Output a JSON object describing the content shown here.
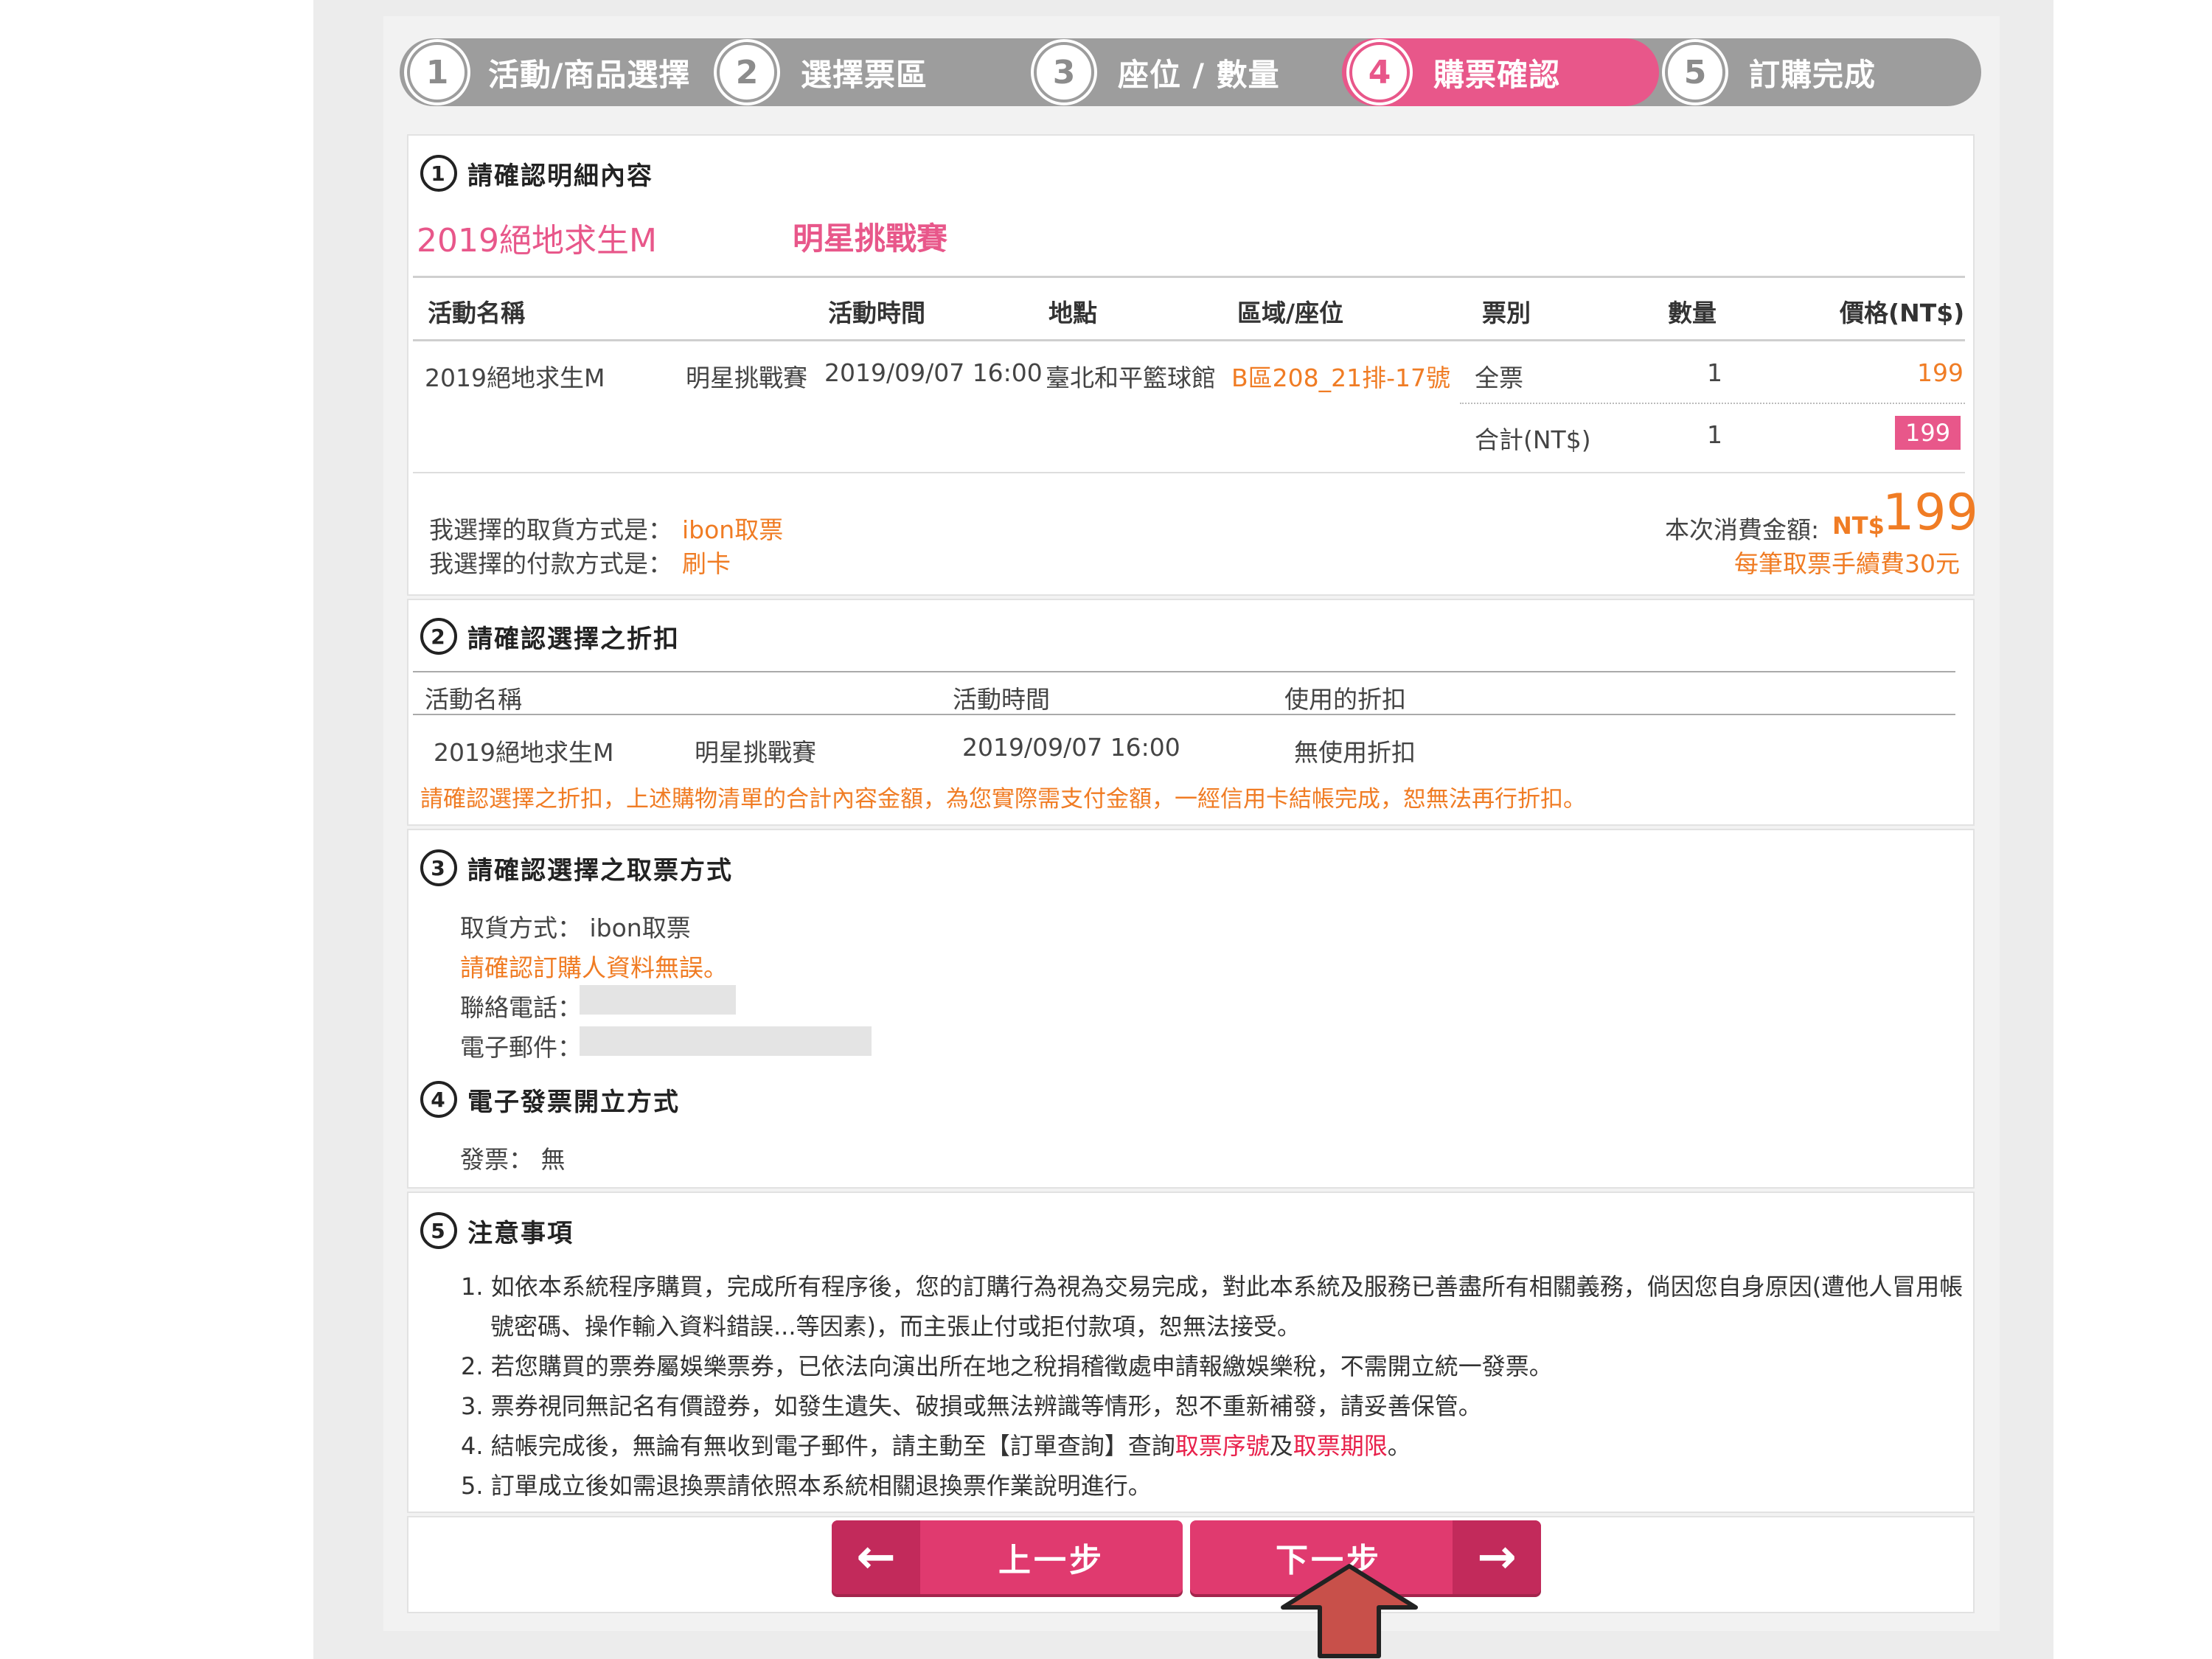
{
  "steps": [
    {
      "num": "1",
      "label": "活動/商品選擇"
    },
    {
      "num": "2",
      "label": "選擇票區"
    },
    {
      "num": "3",
      "label": "座位 / 數量"
    },
    {
      "num": "4",
      "label": "購票確認"
    },
    {
      "num": "5",
      "label": "訂購完成"
    }
  ],
  "section1": {
    "num": "1",
    "title": "請確認明細內容",
    "event_title": "2019絕地求生M",
    "event_subtitle": "明星挑戰賽",
    "headers": [
      "活動名稱",
      "活動時間",
      "地點",
      "區域/座位",
      "票別",
      "數量",
      "價格(NT$)"
    ],
    "row": {
      "name": "2019絕地求生M",
      "name2": "明星挑戰賽",
      "time": "2019/09/07 16:00",
      "place": "臺北和平籃球館",
      "seat": "B區208_21排-17號",
      "type": "全票",
      "qty": "1",
      "price": "199"
    },
    "total_label": "合計(NT$)",
    "total_qty": "1",
    "total_price": "199",
    "pickup_label": "我選擇的取貨方式是：",
    "pickup_value": "ibon取票",
    "payment_label": "我選擇的付款方式是：",
    "payment_value": "刷卡",
    "amount_label": "本次消費金額:",
    "amount_currency": "NT$",
    "amount_value": "199",
    "fee_note": "每筆取票手續費30元"
  },
  "section2": {
    "num": "2",
    "title": "請確認選擇之折扣",
    "headers": [
      "活動名稱",
      "活動時間",
      "使用的折扣"
    ],
    "row": {
      "name": "2019絕地求生M",
      "name2": "明星挑戰賽",
      "time": "2019/09/07 16:00",
      "discount": "無使用折扣"
    },
    "warning": "請確認選擇之折扣，上述購物清單的合計內容金額，為您實際需支付金額，一經信用卡結帳完成，恕無法再行折扣。"
  },
  "section3": {
    "num": "3",
    "title": "請確認選擇之取票方式",
    "pickup": "取貨方式： ibon取票",
    "confirm_note": "請確認訂購人資料無誤。",
    "phone_label": "聯絡電話：",
    "email_label": "電子郵件："
  },
  "section4": {
    "num": "4",
    "title": "電子發票開立方式",
    "invoice": "發票： 無"
  },
  "section5": {
    "num": "5",
    "title": "注意事項",
    "note1": "1. 如依本系統程序購買，完成所有程序後，您的訂購行為視為交易完成，對此本系統及服務已善盡所有相關義務，倘因您自身原因(遭他人冒用帳號密碼、操作輸入資料錯誤...等因素)，而主張止付或拒付款項，恕無法接受。",
    "note2": "2. 若您購買的票券屬娛樂票券，已依法向演出所在地之稅捐稽徵處申請報繳娛樂稅，不需開立統一發票。",
    "note3": "3. 票券視同無記名有價證券，如發生遺失、破損或無法辨識等情形，恕不重新補發，請妥善保管。",
    "note4_a": "4. 結帳完成後，無論有無收到電子郵件，請主動至【訂單查詢】查詢",
    "note4_b": "取票序號",
    "note4_c": "及",
    "note4_d": "取票期限",
    "note4_e": "。",
    "note5": "5. 訂單成立後如需退換票請依照本系統相關退換票作業說明進行。"
  },
  "buttons": {
    "prev": "上一步",
    "next": "下一步",
    "prev_icon": "arrow-left-icon",
    "next_icon": "arrow-right-icon"
  },
  "colors": {
    "accent": "#e8578a",
    "orange": "#f07c24",
    "step_gray": "#9d9d9d",
    "button": "#e03a6f"
  }
}
